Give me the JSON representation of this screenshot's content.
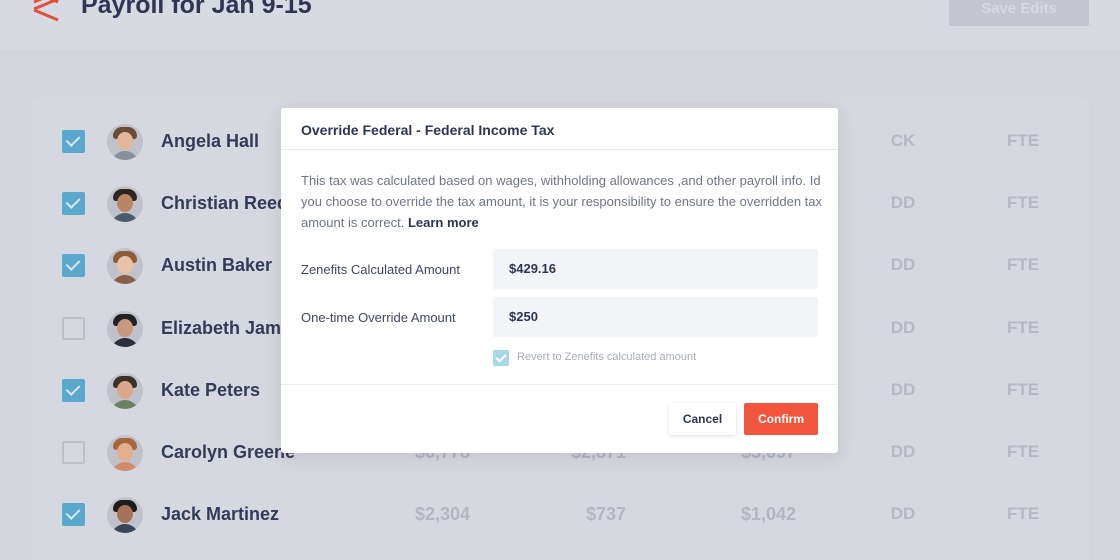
{
  "header": {
    "title": "Payroll for Jan 9-15",
    "save_label": "Save Edits"
  },
  "employees": [
    {
      "name": "Angela Hall",
      "checked": true,
      "col1": "",
      "col2": "",
      "col3": "",
      "payment": "CK",
      "type": "FTE",
      "skin": "#e3b89a",
      "hair": "#6b4a36",
      "shirt": "#8a8f9c"
    },
    {
      "name": "Christian Reed",
      "checked": true,
      "col1": "",
      "col2": "",
      "col3": "",
      "payment": "DD",
      "type": "FTE",
      "skin": "#b98565",
      "hair": "#2b2622",
      "shirt": "#4a5b6a"
    },
    {
      "name": "Austin Baker",
      "checked": true,
      "col1": "",
      "col2": "",
      "col3": "",
      "payment": "DD",
      "type": "FTE",
      "skin": "#e9c3a8",
      "hair": "#8a5c3a",
      "shirt": "#8a5e4d"
    },
    {
      "name": "Elizabeth James",
      "checked": false,
      "col1": "",
      "col2": "",
      "col3": "",
      "payment": "DD",
      "type": "FTE",
      "skin": "#c79a7d",
      "hair": "#1f2124",
      "shirt": "#2a2f3a"
    },
    {
      "name": "Kate Peters",
      "checked": true,
      "col1": "",
      "col2": "",
      "col3": "",
      "payment": "DD",
      "type": "FTE",
      "skin": "#d8a88a",
      "hair": "#3a3129",
      "shirt": "#6e8064"
    },
    {
      "name": "Carolyn Greene",
      "checked": false,
      "col1": "$6,778",
      "col2": "$2,871",
      "col3": "$3,697",
      "payment": "DD",
      "type": "FTE",
      "skin": "#e2ae8c",
      "hair": "#a7673d",
      "shirt": "#d08d6b"
    },
    {
      "name": "Jack Martinez",
      "checked": true,
      "col1": "$2,304",
      "col2": "$737",
      "col3": "$1,042",
      "payment": "DD",
      "type": "FTE",
      "skin": "#a87257",
      "hair": "#1d1b1b",
      "shirt": "#3b4356"
    }
  ],
  "modal": {
    "title": "Override Federal - Federal Income Tax",
    "description": "This tax was calculated based on wages, withholding allowances ,and other payroll info. Id you choose to override the tax amount, it is your responsibility to ensure the overridden tax amount is correct.",
    "learn_more": "Learn more",
    "calculated_label": "Zenefits Calculated Amount",
    "calculated_value": "$429.16",
    "override_label": "One-time Override Amount",
    "override_value": "$250",
    "revert_label": "Revert to Zenefits calculated amount",
    "revert_checked": true,
    "cancel_label": "Cancel",
    "confirm_label": "Confirm"
  },
  "colors": {
    "accent": "#f2553d",
    "checkbox": "#5aa8cc",
    "overlay": "#d3d5dd"
  },
  "icons": {
    "logo": "zenefits-logo-icon"
  }
}
